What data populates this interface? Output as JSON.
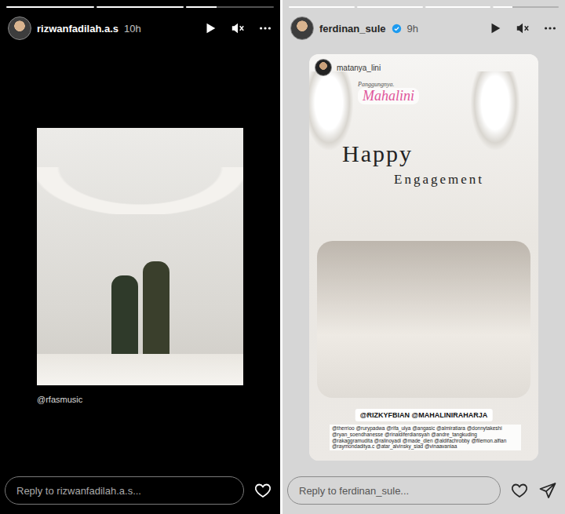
{
  "stories": [
    {
      "kind": "dark",
      "username": "rizwanfadilah.a.s",
      "verified": false,
      "time": "10h",
      "progress": [
        1,
        1,
        0.35
      ],
      "caption": "@rfasmusic",
      "reply_placeholder": "Reply to rizwanfadilah.a.s...",
      "share": false
    },
    {
      "kind": "light",
      "username": "ferdinan_sule",
      "verified": true,
      "time": "9h",
      "progress": [
        1,
        1,
        1,
        0.3
      ],
      "repost": {
        "username": "matanya_lini",
        "sticker_label": "Panggungnya.",
        "sticker_name": "Mahalini",
        "title": "Happy",
        "subtitle": "Engagement",
        "mention": "@RIZKYFBIAN @MAHALINIRAHARJA",
        "tags": "@therrioo @rurypadwa @rifa_ulya @angasic @almiratiara @donnytakeshi @ryan_soendhanesse @rinaldiferdiansyah @andre_tangkuding @rakaggramudita @ralinoyadi @made_dien @aldifachrobby @filemon.alfian @raymondaditya.c @atar_alvinsky_siad @vinaavaniaa"
      },
      "reply_placeholder": "Reply to ferdinan_sule...",
      "share": true
    }
  ]
}
